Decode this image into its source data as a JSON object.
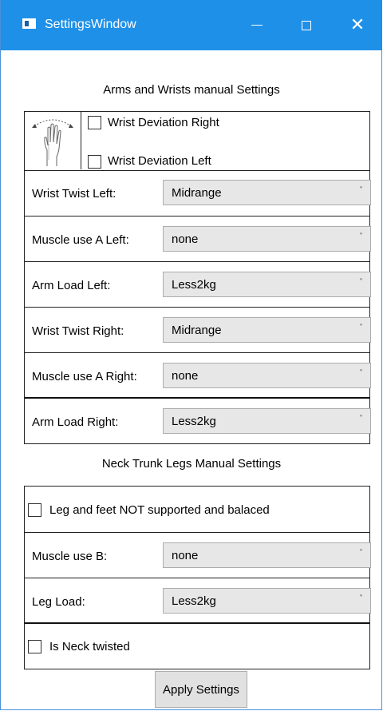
{
  "window": {
    "title": "SettingsWindow",
    "controls": {
      "minimize": "—",
      "maximize": "☐",
      "close": "✕"
    }
  },
  "arms_section": {
    "heading": "Arms and Wrists manual Settings",
    "wrist_icon": "hand-wrist-deviation-icon",
    "wrist_deviation_right": {
      "label": "Wrist Deviation Right",
      "checked": false
    },
    "wrist_deviation_left": {
      "label": "Wrist Deviation Left",
      "checked": false
    },
    "rows": [
      {
        "label": "Wrist Twist Left:",
        "value": "Midrange"
      },
      {
        "label": "Muscle use A Left:",
        "value": "none"
      },
      {
        "label": "Arm Load Left:",
        "value": "Less2kg"
      },
      {
        "label": "Wrist Twist Right:",
        "value": "Midrange"
      },
      {
        "label": "Muscle use A Right:",
        "value": "none"
      },
      {
        "label": "Arm Load Right:",
        "value": "Less2kg"
      }
    ]
  },
  "legs_section": {
    "heading": "Neck Trunk Legs Manual Settings",
    "leg_support": {
      "label": "Leg and feet NOT supported and balaced",
      "checked": false
    },
    "muscle_use_b": {
      "label": "Muscle use B:",
      "value": "none"
    },
    "leg_load": {
      "label": "Leg Load:",
      "value": "Less2kg"
    },
    "neck_twisted": {
      "label": "Is Neck twisted",
      "checked": false
    }
  },
  "apply_button": {
    "label": "Apply Settings"
  },
  "combo_arrow": "˅",
  "colors": {
    "titlebar": "#1e90e8",
    "combo_bg": "#e7e7e7",
    "button_bg": "#e1e1e1"
  }
}
